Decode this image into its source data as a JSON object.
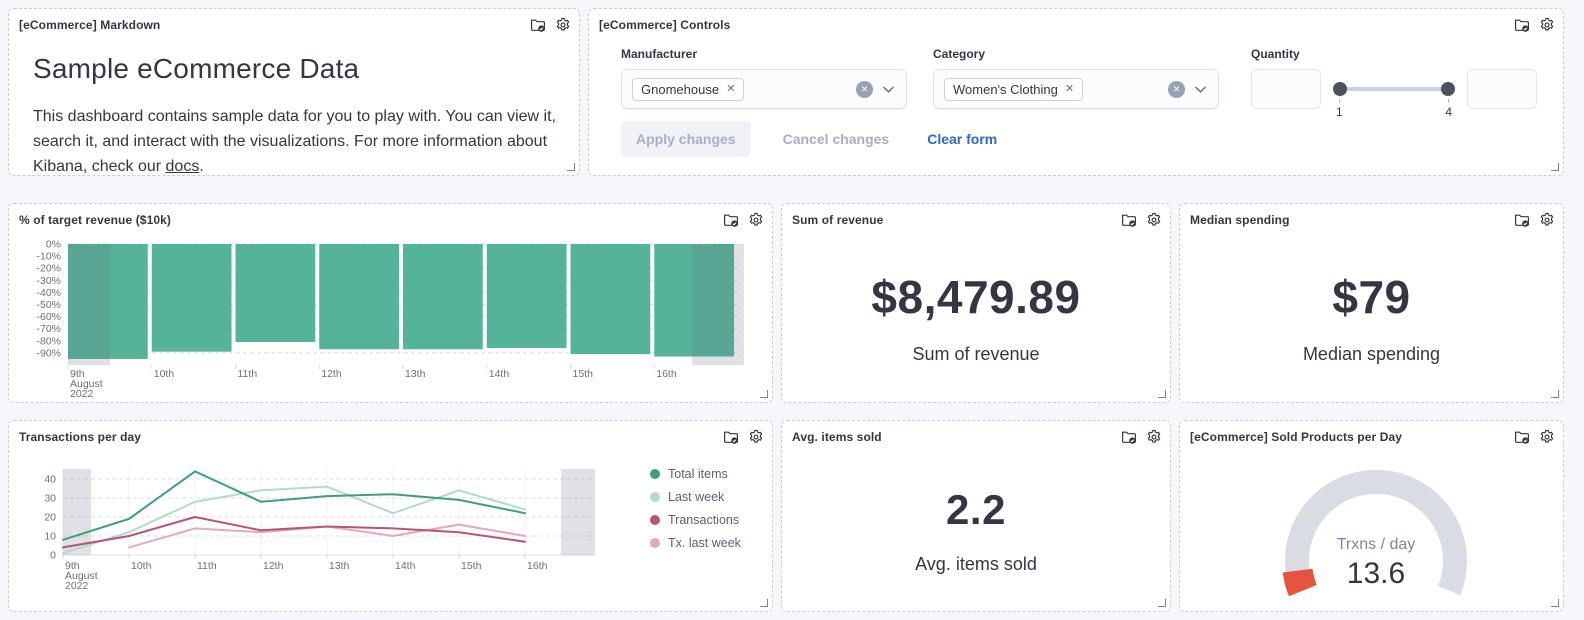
{
  "icons": {
    "library": "folder-check-icon",
    "settings": "gear-icon",
    "dropdown": "chevron-down-icon",
    "clear_selection": "cross-circle-icon",
    "remove_pill": "cross-icon"
  },
  "colors": {
    "link_blue": "#3166cc",
    "metric_text": "#343741",
    "bar_green": "#54B399",
    "gauge_band": "#d9dce2",
    "gauge_value": "#e4543f",
    "partial_band": "rgba(110,119,132,0.22)"
  },
  "panels": {
    "markdown": {
      "title": "[eCommerce] Markdown",
      "heading": "Sample eCommerce Data",
      "body": "This dashboard contains sample data for you to play with. You can view it, search it, and interact with the visualizations. For more information about Kibana, check our ",
      "link_text": "docs",
      "body_suffix": "."
    },
    "controls": {
      "title": "[eCommerce] Controls",
      "manufacturer": {
        "label": "Manufacturer",
        "selected": "Gnomehouse"
      },
      "category": {
        "label": "Category",
        "selected": "Women's Clothing"
      },
      "quantity": {
        "label": "Quantity",
        "lower": "1",
        "upper": "4",
        "min_input_value": "",
        "max_input_value": ""
      },
      "apply_label": "Apply changes",
      "cancel_label": "Cancel changes",
      "clear_label": "Clear form"
    },
    "target_revenue": {
      "title": "% of target revenue ($10k)"
    },
    "sum_revenue": {
      "title": "Sum of revenue",
      "value": "$8,479.89",
      "label": "Sum of revenue"
    },
    "median_spending": {
      "title": "Median spending",
      "value": "$79",
      "label": "Median spending"
    },
    "transactions": {
      "title": "Transactions per day"
    },
    "avg_items": {
      "title": "Avg. items sold",
      "value": "2.2",
      "label": "Avg. items sold"
    },
    "sold_products": {
      "title": "[eCommerce] Sold Products per Day"
    }
  },
  "chart_data": [
    {
      "type": "bar",
      "title": "% of target revenue ($10k)",
      "categories": [
        "9th August 2022",
        "10th",
        "11th",
        "12th",
        "13th",
        "14th",
        "15th",
        "16th"
      ],
      "values": [
        -95,
        -89,
        -81,
        -87,
        -87,
        -86,
        -91,
        -93
      ],
      "yticks": [
        "0%",
        "-10%",
        "-20%",
        "-30%",
        "-40%",
        "-50%",
        "-60%",
        "-70%",
        "-80%",
        "-90%"
      ],
      "ylim": [
        0,
        -100
      ],
      "xlabel": "",
      "ylabel": "",
      "grid": true,
      "bar_color": "#54B399",
      "partial_bucket_edges": true
    },
    {
      "type": "line",
      "title": "Transactions per day",
      "x": [
        "9th August 2022",
        "10th",
        "11th",
        "12th",
        "13th",
        "14th",
        "15th",
        "16th"
      ],
      "ylim": [
        0,
        45
      ],
      "yticks": [
        0,
        10,
        20,
        30,
        40
      ],
      "grid": true,
      "legend_position": "right",
      "series": [
        {
          "name": "Total items",
          "color": "#3f9e7a",
          "values": [
            8,
            19,
            44,
            28,
            31,
            32,
            29,
            22
          ]
        },
        {
          "name": "Last week",
          "color": "#b2dcc8",
          "values": [
            1,
            12,
            28,
            34,
            36,
            22,
            34,
            24
          ]
        },
        {
          "name": "Transactions",
          "color": "#bb5379",
          "values": [
            4,
            10,
            20,
            13,
            15,
            14,
            12,
            7
          ]
        },
        {
          "name": "Tx. last week",
          "color": "#e3a8ba",
          "values": [
            null,
            4,
            14,
            12,
            15,
            10,
            16,
            10
          ]
        }
      ],
      "partial_bucket_edges": true
    },
    {
      "type": "gauge",
      "title": "[eCommerce] Sold Products per Day",
      "label": "Trxns / day",
      "value": "13.6",
      "band_color": "#d9dce2",
      "value_color": "#e4543f"
    }
  ]
}
